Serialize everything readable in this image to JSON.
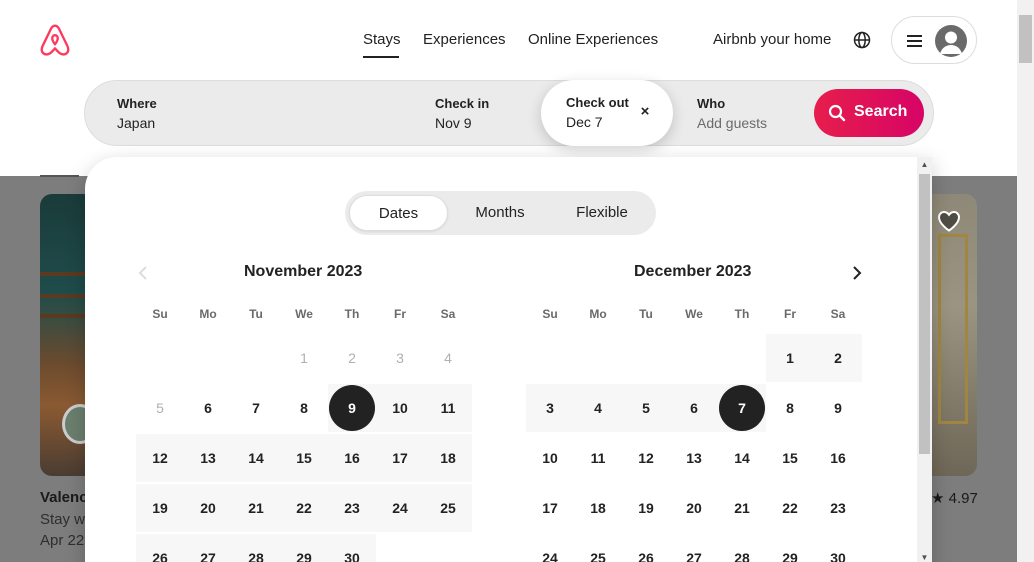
{
  "header": {
    "tabs": [
      {
        "label": "Stays",
        "active": true
      },
      {
        "label": "Experiences",
        "active": false
      },
      {
        "label": "Online Experiences",
        "active": false
      }
    ],
    "host_link": "Airbnb your home",
    "icons": {
      "logo": "airbnb-logo",
      "globe": "globe-icon",
      "menu": "hamburger-icon",
      "avatar": "user-avatar-icon"
    }
  },
  "search": {
    "where": {
      "label": "Where",
      "value": "Japan"
    },
    "check_in": {
      "label": "Check in",
      "value": "Nov 9"
    },
    "check_out": {
      "label": "Check out",
      "value": "Dec 7"
    },
    "who": {
      "label": "Who",
      "placeholder": "Add guests"
    },
    "button_label": "Search",
    "clear_icon": "×"
  },
  "calendar": {
    "modes": [
      "Dates",
      "Months",
      "Flexible"
    ],
    "selected_mode": "Dates",
    "weekdays": [
      "Su",
      "Mo",
      "Tu",
      "We",
      "Th",
      "Fr",
      "Sa"
    ],
    "months": [
      {
        "title": "November 2023",
        "first_weekday": 3,
        "days_shown": 30,
        "disabled_through": 5,
        "selected": [
          9
        ],
        "range_from": 9,
        "range_to": 30
      },
      {
        "title": "December 2023",
        "first_weekday": 5,
        "days_shown": 30,
        "disabled_through": 0,
        "selected": [
          7
        ],
        "range_from": 1,
        "range_to": 7
      }
    ],
    "prev_icon": "chevron-left-icon",
    "next_icon": "chevron-right-icon"
  },
  "background": {
    "listing_left": {
      "title": "Valenc",
      "subtitle": "Stay w",
      "dates": "Apr 22"
    },
    "listing_right": {
      "rating": "4.97"
    },
    "icons": {
      "favorite": "heart-icon",
      "star": "star-icon"
    }
  },
  "colors": {
    "brand": "#FF385C",
    "search_gradient_start": "#E61E4D",
    "search_gradient_end": "#D70466",
    "text": "#222222",
    "selected_day": "#222222",
    "range_fill": "#F7F7F7"
  }
}
